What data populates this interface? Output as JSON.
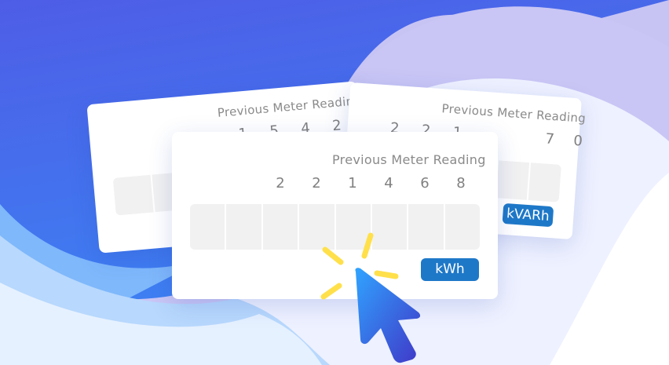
{
  "cards": {
    "back_left": {
      "title": "Previous Meter Reading",
      "digits": [
        "1",
        "5",
        "4",
        "2"
      ]
    },
    "back_right": {
      "title": "Previous Meter Reading",
      "digits": [
        "2",
        "2",
        "1",
        "7",
        "0"
      ],
      "unit": "kVARh"
    },
    "front": {
      "title": "Previous Meter Reading",
      "digits": [
        "2",
        "2",
        "1",
        "4",
        "6",
        "8"
      ],
      "unit": "kWh"
    }
  },
  "colors": {
    "accent": "#1e78c8",
    "background_blue": "#4a62e8",
    "spark": "#ffe04a"
  }
}
